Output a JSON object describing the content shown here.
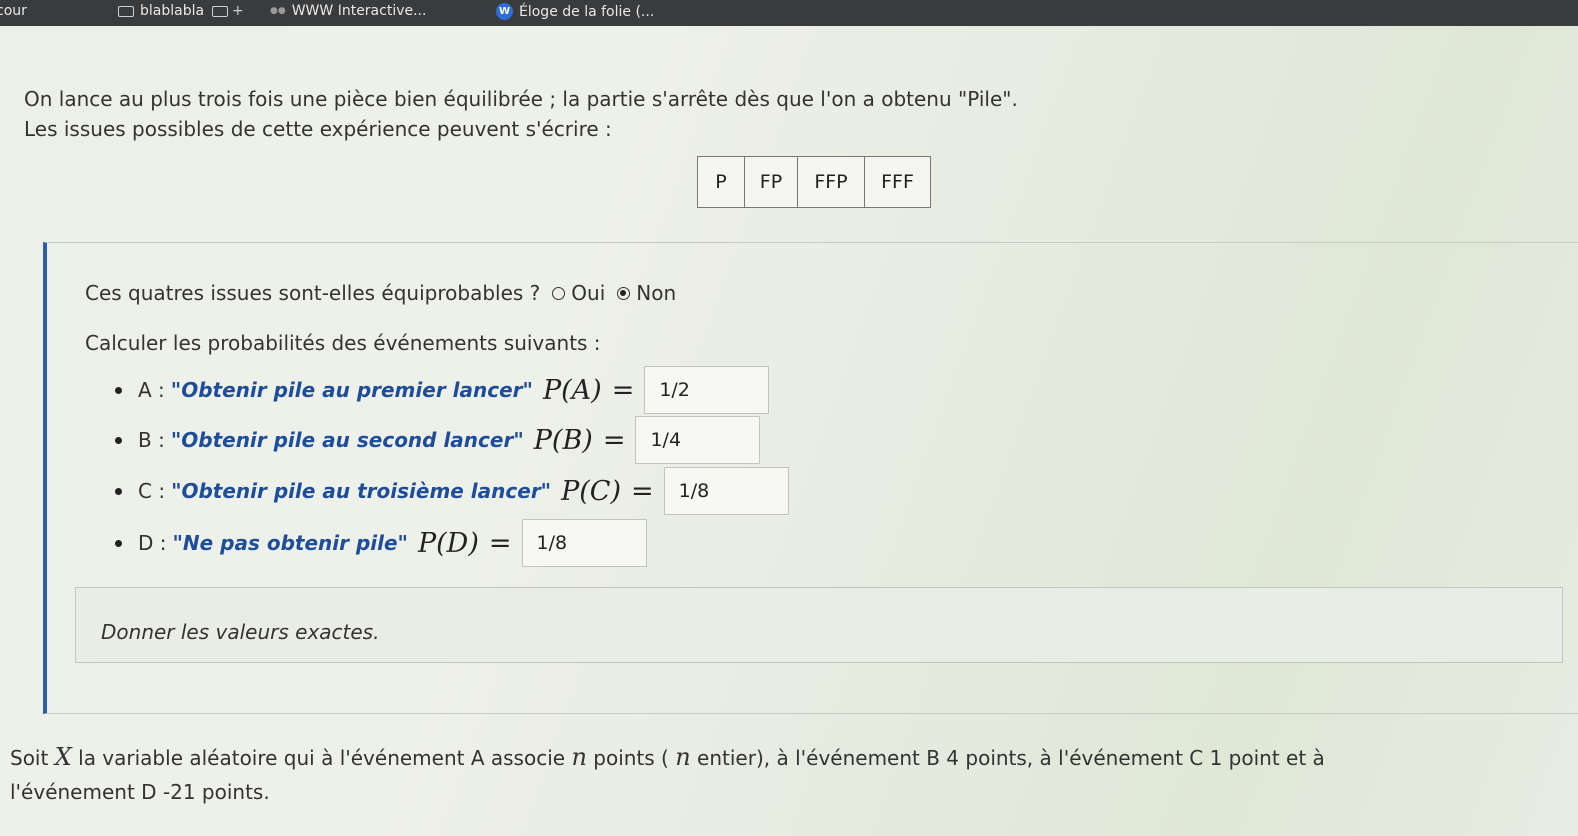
{
  "bookmarks": [
    {
      "label": "cour"
    },
    {
      "label": "blablabla"
    },
    {
      "label": "+"
    },
    {
      "label": "WWW Interactive..."
    },
    {
      "label": "Éloge de la folie (..."
    }
  ],
  "intro": {
    "line1": "On lance au plus trois fois une pièce bien équilibrée ; la partie s'arrête dès que l'on a obtenu \"Pile\".",
    "line2": "Les issues possibles de cette expérience peuvent s'écrire :"
  },
  "issues": [
    "P",
    "FP",
    "FFP",
    "FFF"
  ],
  "question1": {
    "text": "Ces quatres issues sont-elles équiprobables ?",
    "options": [
      {
        "label": "Oui",
        "selected": false
      },
      {
        "label": "Non",
        "selected": true
      }
    ]
  },
  "question2": "Calculer les probabilités des événements suivants :",
  "events": [
    {
      "letter": "A :",
      "desc": "\"Obtenir pile au premier lancer\"",
      "math": "P(A)",
      "eq": "=",
      "answer": "1/2"
    },
    {
      "letter": "B :",
      "desc": "\"Obtenir pile au second lancer\"",
      "math": "P(B)",
      "eq": "=",
      "answer": "1/4"
    },
    {
      "letter": "C :",
      "desc": "\"Obtenir pile au troisième lancer\"",
      "math": "P(C)",
      "eq": "=",
      "answer": "1/8"
    },
    {
      "letter": "D :",
      "desc": "\"Ne pas obtenir pile\"",
      "math": "P(D)",
      "eq": "=",
      "answer": "1/8"
    }
  ],
  "note": "Donner les valeurs exactes.",
  "soit": {
    "p1": "Soit ",
    "x": "X",
    "p2": " la variable aléatoire qui à l'événement A associe ",
    "n1": "n",
    "p3": " points ( ",
    "n2": "n",
    "p4": " entier), à l'événement B 4 points, à l'événement C 1 point et à",
    "line2": "l'événement D -21 points."
  },
  "colors": {
    "accent": "#2d5fa8",
    "desc_text": "#1f4e98"
  }
}
